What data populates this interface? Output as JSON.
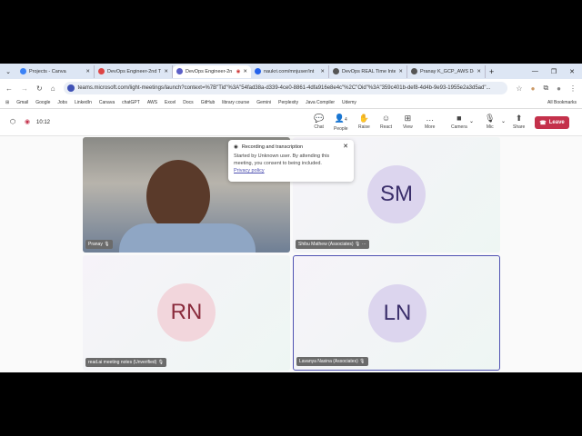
{
  "browser": {
    "tabs": [
      {
        "title": "Projects - Canva",
        "color": "#3b82f6"
      },
      {
        "title": "DevOps Engineer-2nd Tr",
        "color": "#d44"
      },
      {
        "title": "DevOps Engineer-2n",
        "color": "#5b5fc7",
        "active": true
      },
      {
        "title": "naukri.com/mnjuser/int",
        "color": "#2563eb"
      },
      {
        "title": "DevOps REAL Time Inter",
        "color": "#555"
      },
      {
        "title": "Pranay K_GCP_AWS Dev",
        "color": "#555"
      }
    ],
    "new_tab": "+",
    "url": "teams.microsoft.com/light-meetings/launch?context=%7B\"Tid\"%3A\"54fad38a-d339-4ce0-8861-4dfa916e8e4c\"%2C\"Oid\"%3A\"359c401b-def8-4d4b-9e93-1955e2a3d5ad\"...",
    "bookmarks": [
      "Gmail",
      "Google",
      "Jobs",
      "LinkedIn",
      "Canava",
      "chatGPT",
      "AWS",
      "Excel",
      "Docs",
      "GitHub",
      "library course",
      "Gemini",
      "Perplexity",
      "Java Compiler",
      "Udemy"
    ],
    "all_bookmarks": "All Bookmarks"
  },
  "meeting": {
    "timer": "10:12",
    "controls": [
      {
        "label": "Chat",
        "icon": "chat-icon"
      },
      {
        "label": "People",
        "icon": "people-icon",
        "count": "4"
      },
      {
        "label": "Raise",
        "icon": "hand-icon"
      },
      {
        "label": "React",
        "icon": "smile-icon"
      },
      {
        "label": "View",
        "icon": "grid-icon"
      },
      {
        "label": "More",
        "icon": "more-icon"
      },
      {
        "label": "Camera",
        "icon": "camera-icon"
      },
      {
        "label": "Mic",
        "icon": "mic-icon"
      },
      {
        "label": "Share",
        "icon": "share-icon"
      }
    ],
    "leave": "Leave",
    "toast": {
      "title": "Recording and transcription",
      "body": "Started by Unknown user. By attending this meeting, you consent to being included.",
      "link": "Privacy policy"
    },
    "participants": [
      {
        "name": "Pranay",
        "initials": ""
      },
      {
        "name": "Shibu Mathew (Associates)",
        "initials": "SM",
        "color": "#dcd5ee",
        "text": "#3b2f6b"
      },
      {
        "name": "read.ai meeting notes (Unverified)",
        "initials": "RN",
        "color": "#f2d6dc",
        "text": "#8a2b3c"
      },
      {
        "name": "Lavanya Nasina (Associates)",
        "initials": "LN",
        "color": "#dcd5ee",
        "text": "#3b2f6b"
      }
    ]
  }
}
